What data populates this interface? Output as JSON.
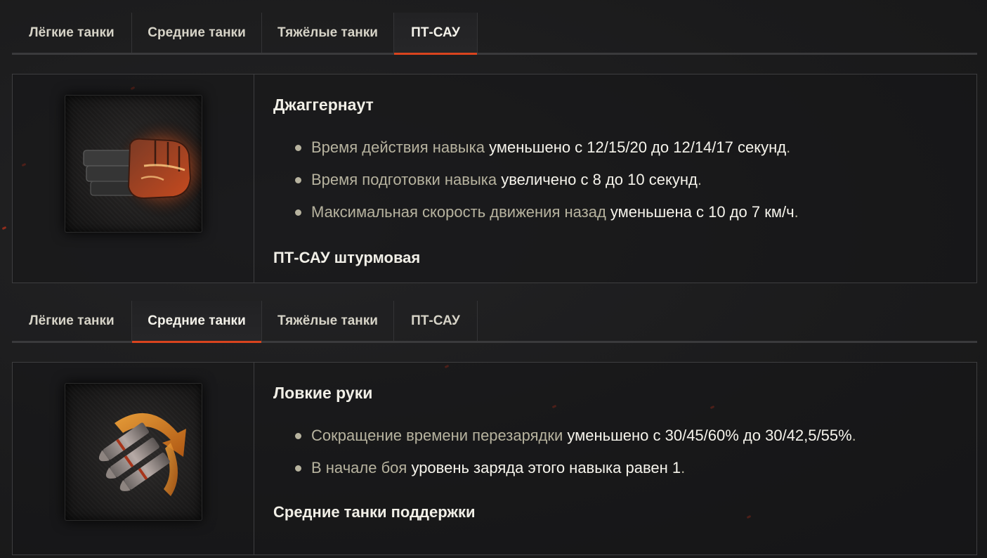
{
  "sections": [
    {
      "tabs": [
        "Лёгкие танки",
        "Средние танки",
        "Тяжёлые танки",
        "ПТ-САУ"
      ],
      "active_tab": "ПТ-САУ",
      "skill": {
        "icon": "armored-fist-icon",
        "title": "Джаггернаут",
        "bullets": [
          {
            "muted": "Время действия навыка ",
            "strong": "уменьшено с 12/15/20 до 12/14/17 секунд",
            "tail": "."
          },
          {
            "muted": "Время подготовки навыка ",
            "strong": "увеличено с 8 до 10 секунд",
            "tail": "."
          },
          {
            "muted": "Максимальная скорость движения назад ",
            "strong": "уменьшена с 10 до 7 км/ч",
            "tail": "."
          }
        ],
        "footer": "ПТ-САУ штурмовая"
      }
    },
    {
      "tabs": [
        "Лёгкие танки",
        "Средние танки",
        "Тяжёлые танки",
        "ПТ-САУ"
      ],
      "active_tab": "Средние танки",
      "skill": {
        "icon": "shells-reload-icon",
        "title": "Ловкие руки",
        "bullets": [
          {
            "muted": "Сокращение времени перезарядки ",
            "strong": "уменьшено с 30/45/60% до 30/42,5/55%",
            "tail": "."
          },
          {
            "muted": "В начале боя ",
            "strong": "уровень заряда этого навыка равен 1",
            "tail": "."
          }
        ],
        "footer": "Средние танки поддержки"
      }
    }
  ],
  "colors": {
    "accent": "#d9441e",
    "muted_text": "#b7b39f",
    "background": "#1b1b1c"
  }
}
